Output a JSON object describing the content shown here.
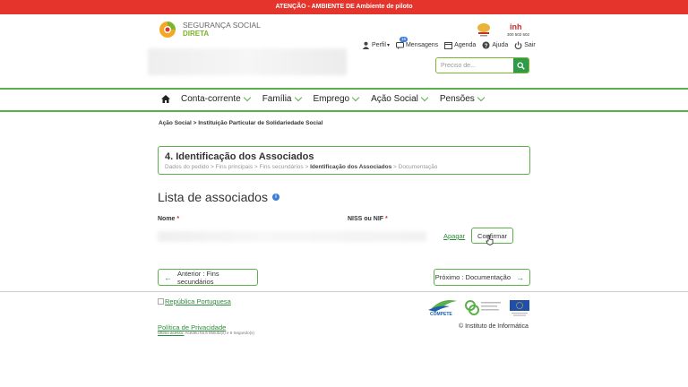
{
  "banner": {
    "text": "ATENÇÃO - AMBIENTE DE Ambiente de piloto"
  },
  "logo": {
    "line1": "SEGURANÇA SOCIAL",
    "line2": "DIRETA"
  },
  "emblem2": {
    "text": "inh",
    "subtext": "300 502 502"
  },
  "toplinks": {
    "perfil": "Perfil",
    "mensagens": "Mensagens",
    "mensagens_badge": "16",
    "agenda": "Agenda",
    "ajuda": "Ajuda",
    "sair": "Sair"
  },
  "search": {
    "placeholder": "Preciso de..."
  },
  "nav": {
    "items": [
      {
        "label": "Conta-corrente"
      },
      {
        "label": "Família"
      },
      {
        "label": "Emprego"
      },
      {
        "label": "Ação Social"
      },
      {
        "label": "Pensões"
      }
    ]
  },
  "breadcrumb": {
    "text": "Ação Social > Instituição Particular de Solidariedade Social"
  },
  "step": {
    "title": "4. Identificação dos Associados",
    "trail_before": "Dados do pedido > Fins principais > Fins secundários > ",
    "trail_current": "Identificação dos Associados",
    "trail_after": " > Documentação"
  },
  "list": {
    "title": "Lista de associados"
  },
  "columns": {
    "nome": "Nome",
    "niss": "NISS ou NIF",
    "required_mark": "*"
  },
  "row": {
    "apagar": "Apagar",
    "confirmar": "Confirmar"
  },
  "pager": {
    "prev": "Anterior : Fins secundários",
    "next": "Próximo : Documentação"
  },
  "footer": {
    "republica": "República Portuguesa",
    "privacy": "Política de Privacidade",
    "last_access_label": "Último acesso:",
    "last_access_value": " Acedeu há 6 Minuto(s) e 9 Segundo(s)",
    "compete": "COMPETE",
    "copyright": "© Instituto de Informática"
  },
  "colors": {
    "accent": "#5ab04a",
    "banner": "#e5342b",
    "link": "#2e8a3a",
    "badge": "#3b7dd8"
  }
}
